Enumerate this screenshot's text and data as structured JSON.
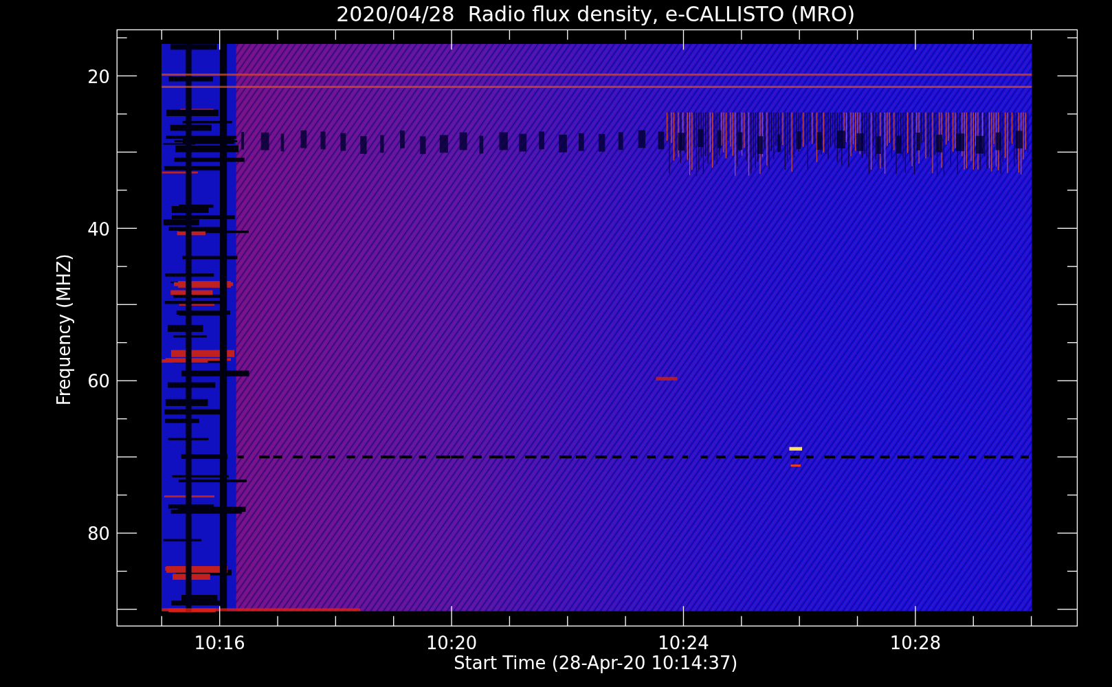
{
  "title": "2020/04/28  Radio flux density, e-CALLISTO (MRO)",
  "y_axis": {
    "label": "Frequency (MHZ)",
    "tick_labels": [
      "20",
      "40",
      "60",
      "80"
    ]
  },
  "x_axis": {
    "label": "Start Time (28-Apr-20 10:14:37)",
    "tick_labels": [
      "10:16",
      "10:20",
      "10:24",
      "10:28"
    ]
  }
}
